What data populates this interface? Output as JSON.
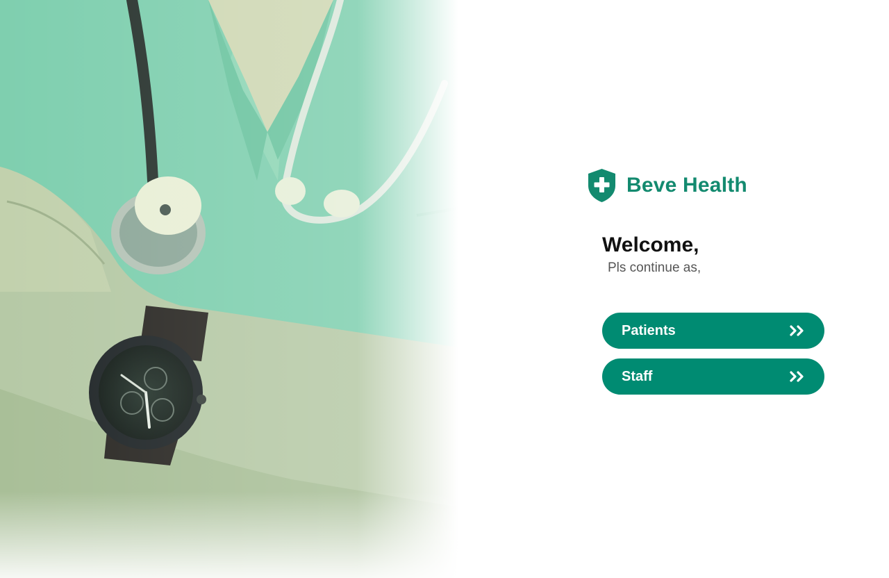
{
  "brand": {
    "name": "Beve Health",
    "logo_icon": "shield-plus-icon",
    "color": "#138a6f"
  },
  "welcome": {
    "title": "Welcome,",
    "subtitle": "Pls continue as,"
  },
  "actions": [
    {
      "label": "Patients",
      "icon": "double-chevron-right-icon"
    },
    {
      "label": "Staff",
      "icon": "double-chevron-right-icon"
    }
  ],
  "colors": {
    "accent": "#008b72",
    "title": "#111111",
    "subtitle": "#555555"
  },
  "hero": {
    "image": "doctor-with-stethoscope-and-wristwatch-photo"
  }
}
